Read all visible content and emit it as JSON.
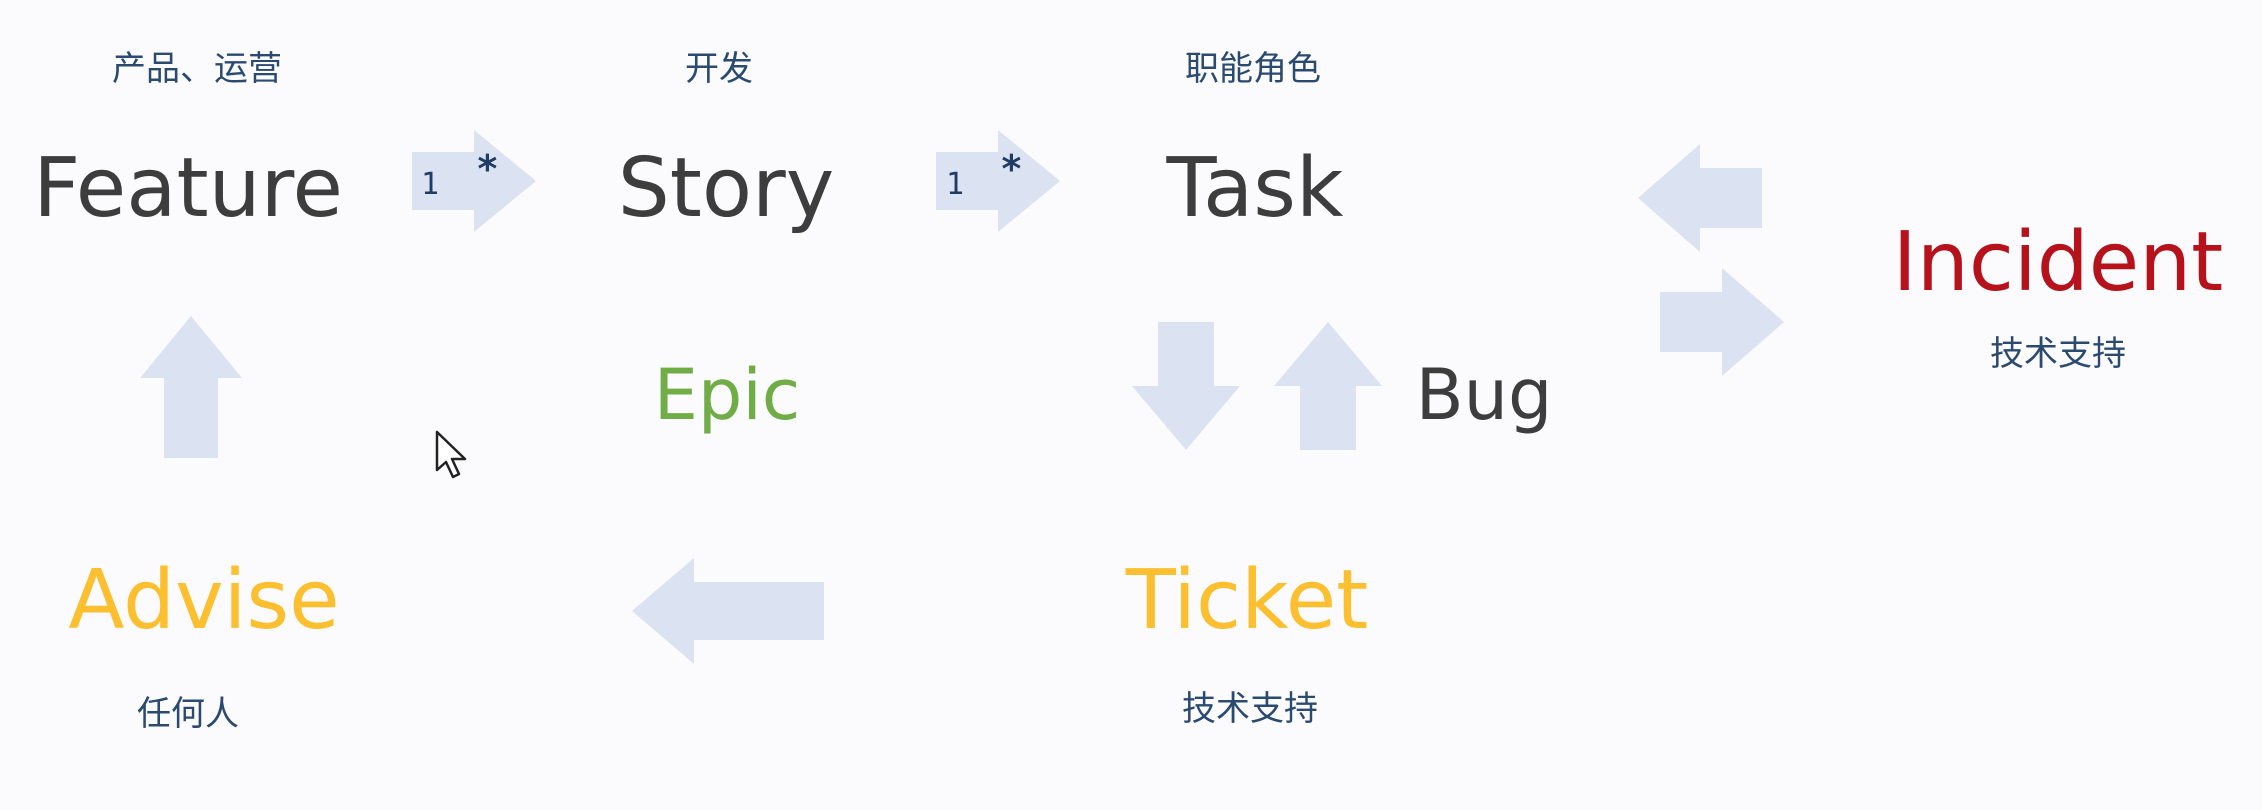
{
  "nodes": {
    "feature": {
      "label": "Feature",
      "role": "产品、运营",
      "color": "#3d3d3d"
    },
    "story": {
      "label": "Story",
      "role": "开发",
      "color": "#3d3d3d"
    },
    "task": {
      "label": "Task",
      "role": "职能角色",
      "color": "#3d3d3d"
    },
    "incident": {
      "label": "Incident",
      "role": "技术支持",
      "color": "#b5121b"
    },
    "epic": {
      "label": "Epic",
      "color": "#70ad47"
    },
    "bug": {
      "label": "Bug",
      "color": "#3d3d3d"
    },
    "advise": {
      "label": "Advise",
      "role": "任何人",
      "color": "#fbbf2f"
    },
    "ticket": {
      "label": "Ticket",
      "role": "技术支持",
      "color": "#fbbf2f"
    }
  },
  "multiplicity": {
    "feature_story": {
      "one": "1",
      "many": "*"
    },
    "story_task": {
      "one": "1",
      "many": "*"
    }
  },
  "colors": {
    "arrow_fill": "#dbe3f2",
    "role_text": "#2b4a70",
    "multiplicity_text": "#1f3b66"
  }
}
